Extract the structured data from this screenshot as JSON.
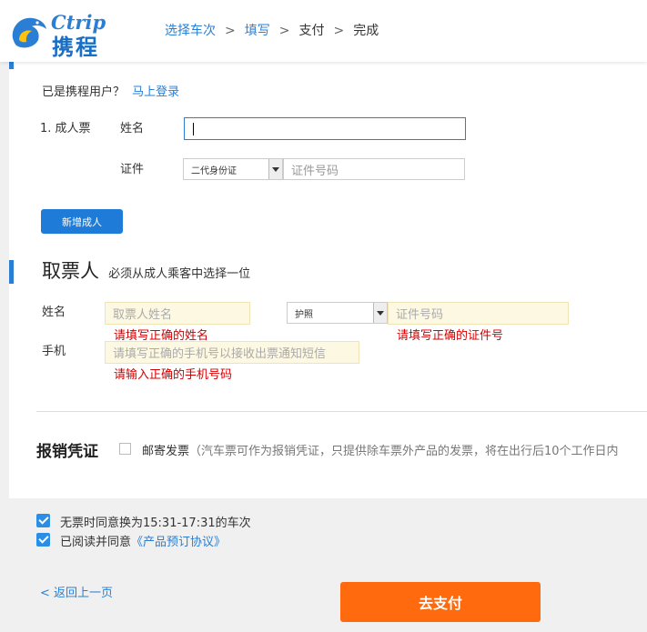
{
  "header": {
    "logo_latin": "Ctrip",
    "logo_cn": "携程",
    "steps": [
      {
        "label": "选择车次"
      },
      {
        "label": "填写"
      },
      {
        "label": "支付"
      },
      {
        "label": "完成"
      }
    ],
    "step_separator": ">"
  },
  "passengers": {
    "login_prompt": "已是携程用户？",
    "login_link": "马上登录",
    "row_label": "1. 成人票",
    "name_label": "姓名",
    "name_value": "",
    "id_label": "证件",
    "id_type": "二代身份证",
    "id_placeholder": "证件号码",
    "add_button": "新增成人"
  },
  "ticket_collector": {
    "title": "取票人",
    "subtitle": "必须从成人乘客中选择一位",
    "name_label": "姓名",
    "name_placeholder": "取票人姓名",
    "name_error": "请填写正确的姓名",
    "id_type": "护照",
    "id_placeholder": "证件号码",
    "id_error": "请填写正确的证件号",
    "phone_label": "手机",
    "phone_placeholder": "请填写正确的手机号以接收出票通知短信",
    "phone_error": "请输入正确的手机号码"
  },
  "invoice": {
    "title": "报销凭证",
    "checkbox_label": "邮寄发票",
    "note": "（汽车票可作为报销凭证，只提供除车票外产品的发票，将在出行后10个工作日内"
  },
  "agreements": {
    "swap_label": "无票时同意换为15:31-17:31的车次",
    "swap_checked": true,
    "agree_prefix": "已阅读并同意",
    "agree_link": "《产品预订协议》",
    "agree_checked": true
  },
  "footer": {
    "back_link": "< 返回上一页",
    "pay_button": "去支付"
  },
  "colors": {
    "accent": "#2a7fd4",
    "pay": "#ff6a0e",
    "error": "#d40000",
    "warn_bg": "#fdf8e1"
  }
}
